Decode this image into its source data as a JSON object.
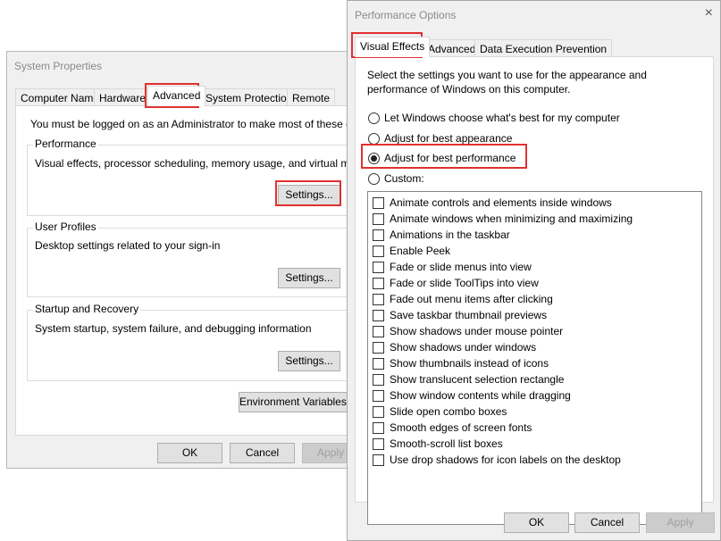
{
  "system_properties": {
    "title": "System Properties",
    "tabs": [
      "Computer Name",
      "Hardware",
      "Advanced",
      "System Protection",
      "Remote"
    ],
    "admin_note": "You must be logged on as an Administrator to make most of these changes.",
    "performance": {
      "title": "Performance",
      "description": "Visual effects, processor scheduling, memory usage, and virtual memory",
      "button": "Settings..."
    },
    "user_profiles": {
      "title": "User Profiles",
      "description": "Desktop settings related to your sign-in",
      "button": "Settings..."
    },
    "startup_recovery": {
      "title": "Startup and Recovery",
      "description": "System startup, system failure, and debugging information",
      "button": "Settings..."
    },
    "env_button": "Environment Variables...",
    "ok": "OK",
    "cancel": "Cancel",
    "apply": "Apply"
  },
  "performance_options": {
    "title": "Performance Options",
    "close_icon": "×",
    "tabs": [
      "Visual Effects",
      "Advanced",
      "Data Execution Prevention"
    ],
    "intro_line1": "Select the settings you want to use for the appearance and",
    "intro_line2": "performance of Windows on this computer.",
    "radios": [
      "Let Windows choose what's best for my computer",
      "Adjust for best appearance",
      "Adjust for best performance",
      "Custom:"
    ],
    "selected_radio": "Adjust for best performance",
    "effects": [
      "Animate controls and elements inside windows",
      "Animate windows when minimizing and maximizing",
      "Animations in the taskbar",
      "Enable Peek",
      "Fade or slide menus into view",
      "Fade or slide ToolTips into view",
      "Fade out menu items after clicking",
      "Save taskbar thumbnail previews",
      "Show shadows under mouse pointer",
      "Show shadows under windows",
      "Show thumbnails instead of icons",
      "Show translucent selection rectangle",
      "Show window contents while dragging",
      "Slide open combo boxes",
      "Smooth edges of screen fonts",
      "Smooth-scroll list boxes",
      "Use drop shadows for icon labels on the desktop"
    ],
    "ok": "OK",
    "cancel": "Cancel",
    "apply": "Apply"
  },
  "highlight_color": "#e03030"
}
